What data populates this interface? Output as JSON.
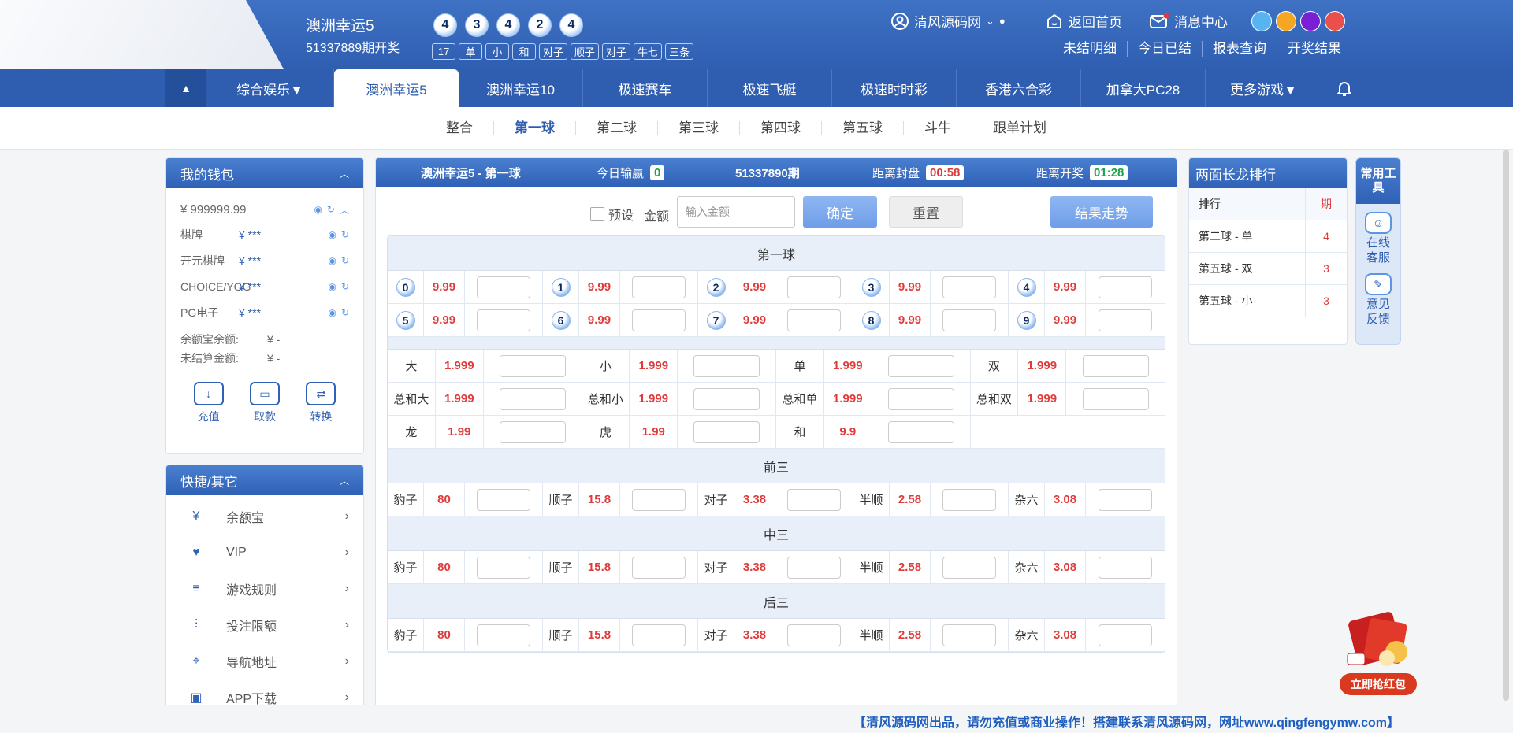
{
  "header": {
    "lottery_name": "澳洲幸运5",
    "lottery_period": "51337889期开奖",
    "balls": [
      "4",
      "3",
      "4",
      "2",
      "4"
    ],
    "tags": [
      "17",
      "单",
      "小",
      "和",
      "对子",
      "顺子",
      "对子",
      "牛七",
      "三条"
    ],
    "user_name": "清风源码网",
    "links": {
      "home": "返回首页",
      "messages": "消息中心"
    },
    "sublinks": [
      "未结明细",
      "今日已结",
      "报表查询",
      "开奖结果"
    ],
    "theme_colors": [
      "#58b4f0",
      "#f5a623",
      "#7b1fd6",
      "#e9504b"
    ]
  },
  "nav": {
    "items": [
      {
        "label": "综合娱乐▼",
        "width": 162
      },
      {
        "label": "澳洲幸运5",
        "width": 158
      },
      {
        "label": "澳洲幸运10",
        "width": 158
      },
      {
        "label": "极速赛车",
        "width": 158
      },
      {
        "label": "极速飞艇",
        "width": 158
      },
      {
        "label": "极速时时彩",
        "width": 158
      },
      {
        "label": "香港六合彩",
        "width": 158
      },
      {
        "label": "加拿大PC28",
        "width": 158
      },
      {
        "label": "更多游戏▼",
        "width": 148
      }
    ],
    "active_index": 1
  },
  "subnav": {
    "items": [
      "整合",
      "第一球",
      "第二球",
      "第三球",
      "第四球",
      "第五球",
      "斗牛",
      "跟单计划"
    ],
    "active_index": 1
  },
  "wallet": {
    "title": "我的钱包",
    "balance": "¥ 999999.99",
    "items": [
      {
        "label": "棋牌",
        "value": "¥ ***"
      },
      {
        "label": "开元棋牌",
        "value": "¥ ***"
      },
      {
        "label": "CHOICE/YGG",
        "value": "¥ ***"
      },
      {
        "label": "PG电子",
        "value": "¥ ***"
      }
    ],
    "yuebao_label": "余额宝余额:",
    "yuebao_value": "¥ -",
    "unsettled_label": "未结算金额:",
    "unsettled_value": "¥ -",
    "actions": [
      "充值",
      "取款",
      "转换"
    ]
  },
  "quick": {
    "title": "快捷/其它",
    "items": [
      "余额宝",
      "VIP",
      "游戏规则",
      "投注限额",
      "导航地址",
      "APP下载"
    ]
  },
  "main": {
    "title": "澳洲幸运5 - 第一球",
    "today_label": "今日输赢",
    "today_value": "0",
    "period": "51337890期",
    "close_label": "距离封盘",
    "close_value": "00:58",
    "draw_label": "距离开奖",
    "draw_value": "01:28",
    "preset_label": "预设",
    "amount_label": "金额",
    "amount_placeholder": "输入金额",
    "confirm": "确定",
    "reset": "重置",
    "trend": "结果走势",
    "section1_title": "第一球",
    "numbers": [
      {
        "n": "0",
        "odds": "9.99"
      },
      {
        "n": "1",
        "odds": "9.99"
      },
      {
        "n": "2",
        "odds": "9.99"
      },
      {
        "n": "3",
        "odds": "9.99"
      },
      {
        "n": "4",
        "odds": "9.99"
      },
      {
        "n": "5",
        "odds": "9.99"
      },
      {
        "n": "6",
        "odds": "9.99"
      },
      {
        "n": "7",
        "odds": "9.99"
      },
      {
        "n": "8",
        "odds": "9.99"
      },
      {
        "n": "9",
        "odds": "9.99"
      }
    ],
    "two_sides": [
      [
        {
          "l": "大",
          "o": "1.999"
        },
        {
          "l": "小",
          "o": "1.999"
        },
        {
          "l": "单",
          "o": "1.999"
        },
        {
          "l": "双",
          "o": "1.999"
        }
      ],
      [
        {
          "l": "总和大",
          "o": "1.999"
        },
        {
          "l": "总和小",
          "o": "1.999"
        },
        {
          "l": "总和单",
          "o": "1.999"
        },
        {
          "l": "总和双",
          "o": "1.999"
        }
      ],
      [
        {
          "l": "龙",
          "o": "1.99"
        },
        {
          "l": "虎",
          "o": "1.99"
        },
        {
          "l": "和",
          "o": "9.9"
        }
      ]
    ],
    "groups": [
      {
        "title": "前三",
        "items": [
          {
            "l": "豹子",
            "o": "80"
          },
          {
            "l": "顺子",
            "o": "15.8"
          },
          {
            "l": "对子",
            "o": "3.38"
          },
          {
            "l": "半顺",
            "o": "2.58"
          },
          {
            "l": "杂六",
            "o": "3.08"
          }
        ]
      },
      {
        "title": "中三",
        "items": [
          {
            "l": "豹子",
            "o": "80"
          },
          {
            "l": "顺子",
            "o": "15.8"
          },
          {
            "l": "对子",
            "o": "3.38"
          },
          {
            "l": "半顺",
            "o": "2.58"
          },
          {
            "l": "杂六",
            "o": "3.08"
          }
        ]
      },
      {
        "title": "后三",
        "items": [
          {
            "l": "豹子",
            "o": "80"
          },
          {
            "l": "顺子",
            "o": "15.8"
          },
          {
            "l": "对子",
            "o": "3.38"
          },
          {
            "l": "半顺",
            "o": "2.58"
          },
          {
            "l": "杂六",
            "o": "3.08"
          }
        ]
      }
    ]
  },
  "long_dragon": {
    "title": "两面长龙排行",
    "col1": "排行",
    "col2": "期",
    "rows": [
      {
        "name": "第二球 - 单",
        "count": "4"
      },
      {
        "name": "第五球 - 双",
        "count": "3"
      },
      {
        "name": "第五球 - 小",
        "count": "3"
      }
    ]
  },
  "tools": {
    "title": "常用工具",
    "items": [
      "在线客服",
      "意见反馈"
    ]
  },
  "redpacket": {
    "label": "立即抢红包"
  },
  "footer": {
    "text": "【清风源码网出品，请勿充值或商业操作！搭建联系清风源码网，网址www.qingfengymw.com】"
  }
}
